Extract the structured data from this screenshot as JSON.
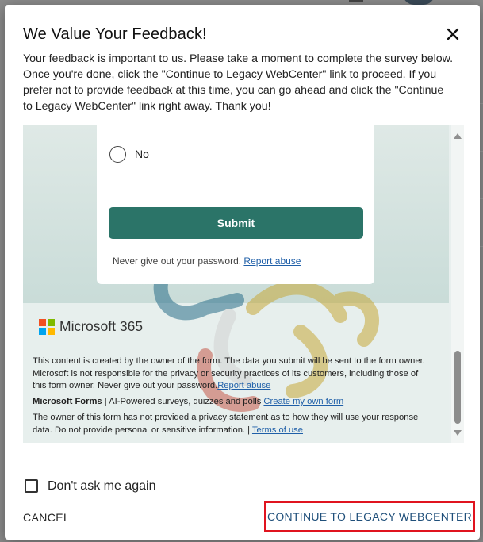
{
  "dialog": {
    "title": "We Value Your Feedback!",
    "intro": "Your feedback is important to us. Please take a moment to complete the survey below. Once you're done, click the \"Continue to Legacy WebCenter\" link to proceed. If you prefer not to provide feedback at this time, you can go ahead and click the \"Continue to Legacy WebCenter\" link right away. Thank you!",
    "close_icon": "close-icon"
  },
  "form": {
    "radio_option": "No",
    "submit_label": "Submit",
    "password_note": "Never give out your password.",
    "report_abuse": "Report abuse",
    "brand": "Microsoft 365",
    "brand_colors": [
      "#f25022",
      "#7fba00",
      "#00a4ef",
      "#ffb900"
    ],
    "disclaimer": "This content is created by the owner of the form. The data you submit will be sent to the form owner. Microsoft is not responsible for the privacy or security practices of its customers, including those of this form owner. Never give out your password.",
    "disclaimer_link": "Report abuse",
    "forms_name": "Microsoft Forms",
    "forms_tagline": " | AI-Powered surveys, quizzes and polls ",
    "create_link": "Create my own form",
    "privacy_note": "The owner of this form has not provided a privacy statement as to how they will use your response data. Do not provide personal or sensitive information. | ",
    "terms_link": "Terms of use",
    "accent_color": "#2b7468"
  },
  "footer": {
    "dont_ask_label": "Don't ask me again",
    "dont_ask_checked": false,
    "cancel_label": "CANCEL",
    "continue_label": "CONTINUE TO LEGACY WEBCENTER",
    "highlight_color": "#e0141f"
  }
}
